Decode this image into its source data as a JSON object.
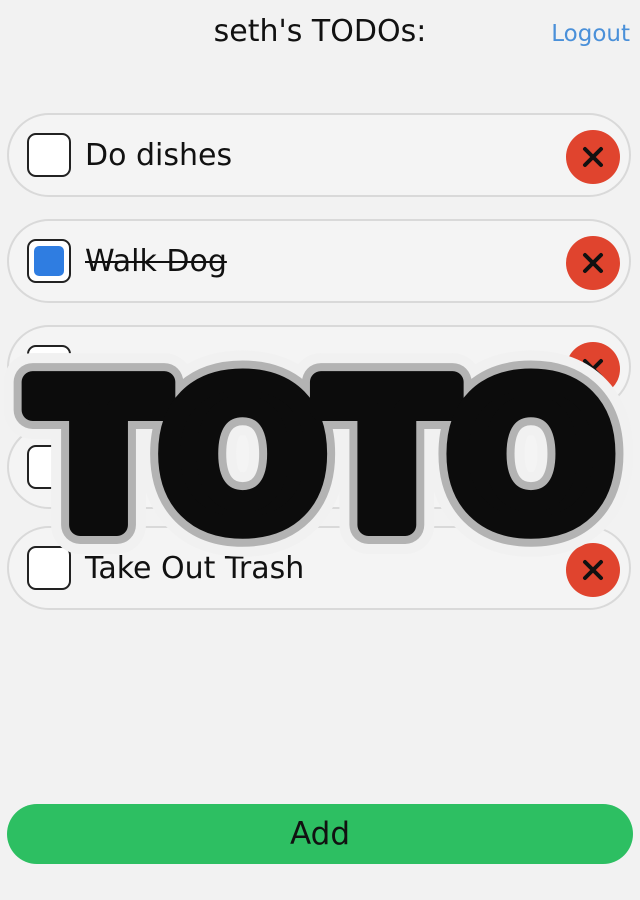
{
  "header": {
    "title": "seth's TODOs:",
    "logout_label": "Logout"
  },
  "todos": [
    {
      "label": "Do dishes",
      "completed": false
    },
    {
      "label": "Walk Dog",
      "completed": true
    },
    {
      "label": "",
      "completed": false
    },
    {
      "label": "",
      "completed": false
    },
    {
      "label": "Take Out Trash",
      "completed": false
    }
  ],
  "add_button": {
    "label": "Add"
  },
  "watermark": {
    "text": "TOTO"
  },
  "colors": {
    "accent_blue": "#2f7de1",
    "link_blue": "#4a90d9",
    "delete_red": "#e0442e",
    "add_green": "#2dbf62",
    "background": "#f2f2f2"
  }
}
